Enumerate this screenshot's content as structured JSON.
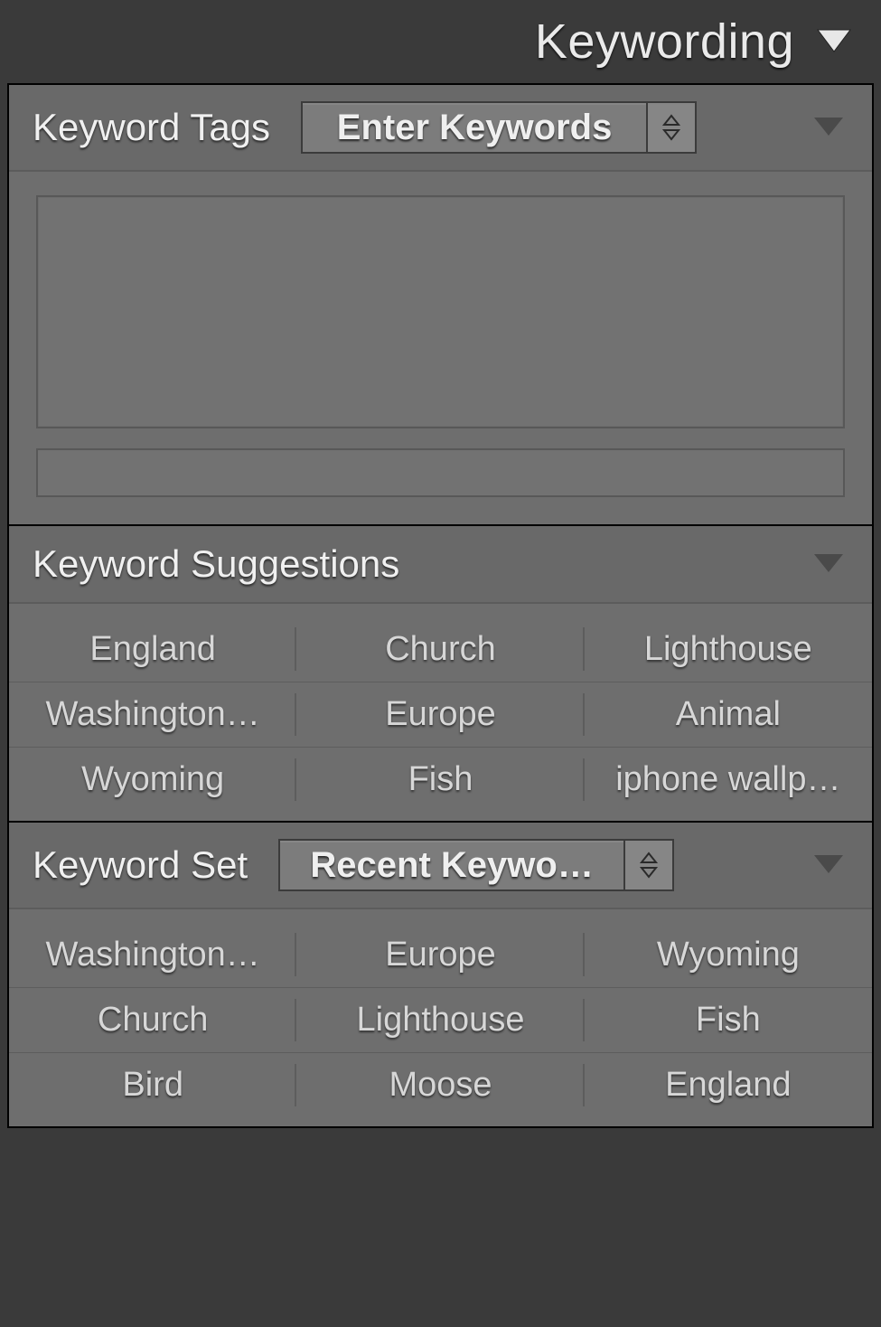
{
  "panel": {
    "title": "Keywording"
  },
  "tags": {
    "label": "Keyword Tags",
    "dropdown": "Enter Keywords"
  },
  "suggestions": {
    "label": "Keyword Suggestions",
    "items": [
      "England",
      "Church",
      "Lighthouse",
      "Washington…",
      "Europe",
      "Animal",
      "Wyoming",
      "Fish",
      "iphone wallp…"
    ]
  },
  "set": {
    "label": "Keyword Set",
    "dropdown": "Recent Keywo…",
    "items": [
      "Washington…",
      "Europe",
      "Wyoming",
      "Church",
      "Lighthouse",
      "Fish",
      "Bird",
      "Moose",
      "England"
    ]
  }
}
